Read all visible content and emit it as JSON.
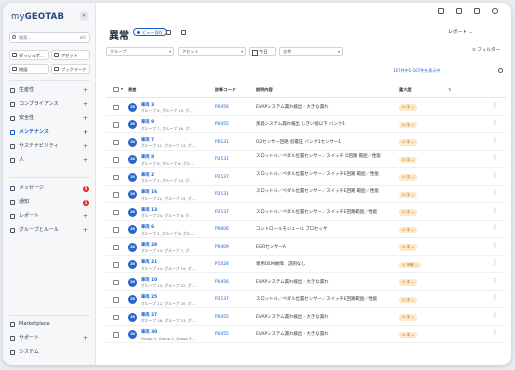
{
  "colors": {
    "accent": "#1a5fd0",
    "badge": "#d92d20",
    "severity_bg": "#fde8c8",
    "severity_fg": "#b35c00"
  },
  "sidebar": {
    "logo_my": "my",
    "logo_brand": "GEOTAB",
    "collapse": "«",
    "search_placeholder": "検索...",
    "search_shortcut": "⌘K",
    "quick": [
      "ダッシュボ...",
      "アセット",
      "地図",
      "ブックマーク"
    ],
    "items": [
      {
        "label": "生産性",
        "icon": "productivity-icon"
      },
      {
        "label": "コンプライアンス",
        "icon": "compliance-icon"
      },
      {
        "label": "安全性",
        "icon": "safety-icon"
      },
      {
        "label": "メンテナンス",
        "icon": "maintenance-icon",
        "active": true
      },
      {
        "label": "サステナビリティ",
        "icon": "sustainability-icon"
      },
      {
        "label": "人",
        "icon": "people-icon"
      }
    ],
    "items2": [
      {
        "label": "メッセージ",
        "icon": "message-icon",
        "badge": "5"
      },
      {
        "label": "通知",
        "icon": "notification-icon",
        "badge": "1"
      },
      {
        "label": "レポート",
        "icon": "report-icon"
      },
      {
        "label": "グループとルール",
        "icon": "groups-icon"
      }
    ],
    "bottom": [
      {
        "label": "Marketplace",
        "icon": "marketplace-icon"
      },
      {
        "label": "サポート",
        "icon": "support-icon"
      },
      {
        "label": "システム",
        "icon": "system-icon"
      }
    ]
  },
  "header": {
    "title": "異常",
    "save_view": "ビュー保存",
    "report": "レポート",
    "group_placeholder": "グループ",
    "asset_placeholder": "アセット",
    "date_label": "今日",
    "all_label": "全件",
    "filter": "フィルター",
    "count": "167件中1-167件を表示中"
  },
  "table": {
    "columns": [
      "資産",
      "診断コード",
      "説明内容",
      "重大度"
    ],
    "rows": [
      {
        "avatar": "26",
        "name": "車両 3",
        "group": "グループ 8, グループ 19, グ...",
        "code": "P0456",
        "desc": "EVAPシステム漏れ検出 - 大きな漏れ",
        "sev": "中"
      },
      {
        "avatar": "26",
        "name": "車両 9",
        "group": "グループ 7, グループ 16, グ...",
        "code": "P0455",
        "desc": "蒸発システム漏れ検出 しきい値以下 バンク1",
        "sev": "中"
      },
      {
        "avatar": "26",
        "name": "車両 7",
        "group": "グループ 11, グループ 13, グ...",
        "code": "P0131",
        "desc": "O2センサー回路 低電圧 バンク1センサー1",
        "sev": "中"
      },
      {
        "avatar": "26",
        "name": "車両 8",
        "group": "グループ 6, グループ 8, グル...",
        "code": "P2131",
        "desc": "スロットル／ペダル位置センサー／スイッチ D回路 範囲／性能",
        "sev": "中"
      },
      {
        "avatar": "26",
        "name": "車両 2",
        "group": "グループ 2, グループ 10, グ...",
        "code": "P2137",
        "desc": "スロットル／ペダル位置センサー／スイッチE回路 範囲／性能",
        "sev": "中"
      },
      {
        "avatar": "26",
        "name": "車両 16",
        "group": "グループ 11, グループ 15, グ...",
        "code": "P2131",
        "desc": "スロットル／ペダル位置センサー／スイッチE回路 範囲／性能",
        "sev": "中"
      },
      {
        "avatar": "26",
        "name": "車両 13",
        "group": "グループ 24, グループ 8, グ...",
        "code": "P2137",
        "desc": "スロットル／ペダル位置センサー／スイッチE回路範囲／性能",
        "sev": "中"
      },
      {
        "avatar": "26",
        "name": "車両 6",
        "group": "グループ 4, グループ 8, グル...",
        "code": "P0606",
        "desc": "コントロールモジュール プロセッサ",
        "sev": "中"
      },
      {
        "avatar": "26",
        "name": "車両 28",
        "group": "グループ 14, グループ 7, グ...",
        "code": "P0409",
        "desc": "EGRセンサーA",
        "sev": "中"
      },
      {
        "avatar": "26",
        "name": "車両 21",
        "group": "グループ 14, グループ 19, グ...",
        "code": "P1028",
        "desc": "専用OEM故障：説明なし",
        "sev": "不明"
      },
      {
        "avatar": "26",
        "name": "車両 10",
        "group": "グループ 10, グループ 22, グ...",
        "code": "P0456",
        "desc": "EVAPシステム漏れ検出 - 大きな漏れ",
        "sev": "中"
      },
      {
        "avatar": "26",
        "name": "車両 25",
        "group": "グループ 12, グループ 20, グ...",
        "code": "P2137",
        "desc": "スロットル／ペダル位置センサー／スイッチE回路範囲／性能",
        "sev": "中"
      },
      {
        "avatar": "26",
        "name": "車両 27",
        "group": "グループ 16, グループ 13, グ...",
        "code": "P0455",
        "desc": "EVAPシステム漏れ検出 - 大きな漏れ",
        "sev": "中"
      },
      {
        "avatar": "26",
        "name": "車両 30",
        "group": "Group 1, Group 2, Group 3...",
        "code": "P0455",
        "desc": "EVAPシステム漏れ検出 - 大きな漏れ",
        "sev": "中"
      }
    ]
  }
}
